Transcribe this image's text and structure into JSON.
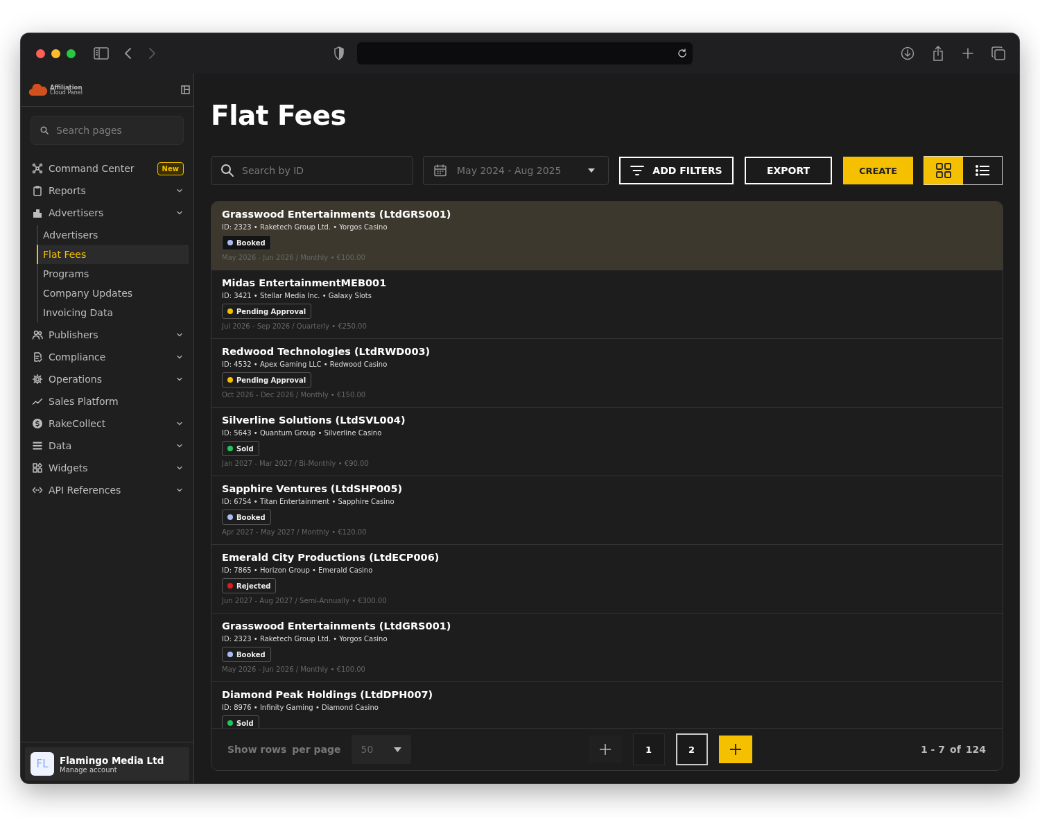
{
  "sidebar": {
    "logo": {
      "line_1": "Affiliation",
      "line_2": "Cloud Panel"
    },
    "search": {
      "placeholder": "Search pages"
    },
    "items": [
      {
        "label": "Command Center",
        "badge": "New",
        "expandable": false,
        "selected": false
      },
      {
        "label": "Reports",
        "expandable": true,
        "selected": false
      },
      {
        "label": "Advertisers",
        "expandable": true,
        "selected": false,
        "children": [
          {
            "label": "Advertisers",
            "selected": false
          },
          {
            "label": "Flat Fees",
            "selected": true
          },
          {
            "label": "Programs",
            "selected": false
          },
          {
            "label": "Company Updates",
            "selected": false
          },
          {
            "label": "Invoicing Data",
            "selected": false
          }
        ]
      },
      {
        "label": "Publishers",
        "expandable": true,
        "selected": false
      },
      {
        "label": "Compliance",
        "expandable": true,
        "selected": false
      },
      {
        "label": "Operations",
        "expandable": true,
        "selected": false
      },
      {
        "label": "Sales Platform",
        "expandable": false,
        "selected": false
      },
      {
        "label": "RakeCollect",
        "expandable": true,
        "selected": false
      },
      {
        "label": "Data",
        "expandable": true,
        "selected": false
      },
      {
        "label": "Widgets",
        "expandable": true,
        "selected": false
      },
      {
        "label": "API References",
        "expandable": true,
        "selected": false
      }
    ],
    "account": {
      "initials": "FL",
      "name": "Flamingo Media Ltd",
      "subtitle": "Manage account"
    }
  },
  "page_title": "Flat Fees",
  "toolbar": {
    "search": {
      "placeholder": "Search by ID"
    },
    "date_range": "May 2024 - Aug 2025",
    "buttons": [
      {
        "label": "ADD FILTERS",
        "kind": "filter"
      },
      {
        "label": "EXPORT",
        "kind": "outline"
      },
      {
        "label": "CREATE",
        "kind": "primary"
      }
    ],
    "views": [
      {
        "kind": "grid",
        "selected": true
      },
      {
        "kind": "list",
        "selected": false
      }
    ]
  },
  "rows": [
    {
      "title": "Grasswood Entertainments (LtdGRS001)",
      "meta": "ID: 2323 • Raketech Group Ltd. • Yorgos Casino",
      "status": "Booked",
      "color": "#a9bdf5",
      "details": "May 2026 - Jun 2026 / Monthly • €100.00",
      "selected": true
    },
    {
      "title": "Midas EntertainmentMEB001",
      "meta": "ID: 3421 • Stellar Media Inc. • Galaxy Slots",
      "status": "Pending Approval",
      "color": "#f5c000",
      "details": "Jul 2026 - Sep 2026 / Quarterly • €250.00",
      "selected": false
    },
    {
      "title": "Redwood Technologies (LtdRWD003)",
      "meta": "ID: 4532 • Apex Gaming LLC • Redwood Casino",
      "status": "Pending Approval",
      "color": "#f5c000",
      "details": "Oct 2026 - Dec 2026 / Monthly • €150.00",
      "selected": false
    },
    {
      "title": "Silverline Solutions (LtdSVL004)",
      "meta": "ID: 5643 • Quantum Group • Silverline Casino",
      "status": "Sold",
      "color": "#22c55e",
      "details": "Jan 2027 - Mar 2027 / Bi-Monthly • €90.00",
      "selected": false
    },
    {
      "title": "Sapphire Ventures (LtdSHP005)",
      "meta": "ID: 6754 • Titan Entertainment • Sapphire Casino",
      "status": "Booked",
      "color": "#a9bdf5",
      "details": "Apr 2027 - May 2027 / Monthly • €120.00",
      "selected": false
    },
    {
      "title": "Emerald City Productions (LtdECP006)",
      "meta": "ID: 7865 • Horizon Group • Emerald Casino",
      "status": "Rejected",
      "color": "#e01b1b",
      "details": "Jun 2027 - Aug 2027 / Semi-Annually • €300.00",
      "selected": false
    },
    {
      "title": "Grasswood Entertainments (LtdGRS001)",
      "meta": "ID: 2323 • Raketech Group Ltd. • Yorgos Casino",
      "status": "Booked",
      "color": "#a9bdf5",
      "details": "May 2026 - Jun 2026 / Monthly • €100.00",
      "selected": false
    },
    {
      "title": "Diamond Peak Holdings (LtdDPH007)",
      "meta": "ID: 8976 • Infinity Gaming • Diamond Casino",
      "status": "Sold",
      "color": "#22c55e",
      "selected": false
    }
  ],
  "footer": {
    "rows_label": "Show rows",
    "per_page_label": "per page",
    "per_page": "50",
    "pages": [
      {
        "label": "1",
        "selected": false
      },
      {
        "label": "2",
        "selected": true
      }
    ],
    "range": "1 - 7",
    "of": "of",
    "total": "124"
  }
}
